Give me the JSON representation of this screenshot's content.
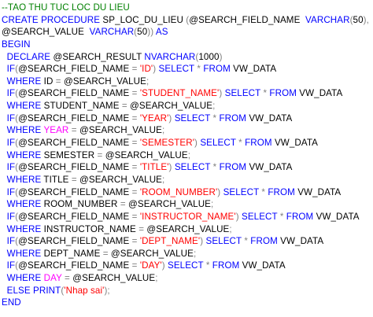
{
  "editor": {
    "lines": [
      [
        {
          "t": "--TAO THU TUC LOC DU LIEU",
          "c": "cmt"
        }
      ],
      [
        {
          "t": "CREATE PROCEDURE",
          "c": "kw"
        },
        {
          "t": " SP_LOC_DU_LIEU ",
          "c": "plain"
        },
        {
          "t": "(",
          "c": "op"
        },
        {
          "t": "@SEARCH_FIELD_NAME  ",
          "c": "plain"
        },
        {
          "t": "VARCHAR",
          "c": "kw"
        },
        {
          "t": "(",
          "c": "op"
        },
        {
          "t": "50",
          "c": "plain"
        },
        {
          "t": "),",
          "c": "op"
        }
      ],
      [
        {
          "t": "@SEARCH_VALUE  ",
          "c": "plain"
        },
        {
          "t": "VARCHAR",
          "c": "kw"
        },
        {
          "t": "(",
          "c": "op"
        },
        {
          "t": "50",
          "c": "plain"
        },
        {
          "t": "))",
          "c": "op"
        },
        {
          "t": " ",
          "c": "plain"
        },
        {
          "t": "AS",
          "c": "kw"
        }
      ],
      [
        {
          "t": "BEGIN",
          "c": "kw"
        }
      ],
      [
        {
          "t": "  ",
          "c": "plain"
        },
        {
          "t": "DECLARE",
          "c": "kw"
        },
        {
          "t": " @SEARCH_RESULT ",
          "c": "plain"
        },
        {
          "t": "NVARCHAR",
          "c": "kw"
        },
        {
          "t": "(",
          "c": "op"
        },
        {
          "t": "1000",
          "c": "plain"
        },
        {
          "t": ")",
          "c": "op"
        }
      ],
      [
        {
          "t": "  ",
          "c": "plain"
        },
        {
          "t": "IF",
          "c": "kw"
        },
        {
          "t": "(",
          "c": "op"
        },
        {
          "t": "@SEARCH_FIELD_NAME ",
          "c": "plain"
        },
        {
          "t": "=",
          "c": "op"
        },
        {
          "t": " ",
          "c": "plain"
        },
        {
          "t": "'ID'",
          "c": "str"
        },
        {
          "t": ")",
          "c": "op"
        },
        {
          "t": " ",
          "c": "plain"
        },
        {
          "t": "SELECT",
          "c": "kw"
        },
        {
          "t": " ",
          "c": "plain"
        },
        {
          "t": "*",
          "c": "op"
        },
        {
          "t": " ",
          "c": "plain"
        },
        {
          "t": "FROM",
          "c": "kw"
        },
        {
          "t": " VW_DATA",
          "c": "plain"
        }
      ],
      [
        {
          "t": "  ",
          "c": "plain"
        },
        {
          "t": "WHERE",
          "c": "kw"
        },
        {
          "t": " ID ",
          "c": "plain"
        },
        {
          "t": "=",
          "c": "op"
        },
        {
          "t": " @SEARCH_VALUE",
          "c": "plain"
        },
        {
          "t": ";",
          "c": "op"
        }
      ],
      [
        {
          "t": "  ",
          "c": "plain"
        },
        {
          "t": "IF",
          "c": "kw"
        },
        {
          "t": "(",
          "c": "op"
        },
        {
          "t": "@SEARCH_FIELD_NAME ",
          "c": "plain"
        },
        {
          "t": "=",
          "c": "op"
        },
        {
          "t": " ",
          "c": "plain"
        },
        {
          "t": "'STUDENT_NAME'",
          "c": "str"
        },
        {
          "t": ")",
          "c": "op"
        },
        {
          "t": " ",
          "c": "plain"
        },
        {
          "t": "SELECT",
          "c": "kw"
        },
        {
          "t": " ",
          "c": "plain"
        },
        {
          "t": "*",
          "c": "op"
        },
        {
          "t": " ",
          "c": "plain"
        },
        {
          "t": "FROM",
          "c": "kw"
        },
        {
          "t": " VW_DATA",
          "c": "plain"
        }
      ],
      [
        {
          "t": "  ",
          "c": "plain"
        },
        {
          "t": "WHERE",
          "c": "kw"
        },
        {
          "t": " STUDENT_NAME ",
          "c": "plain"
        },
        {
          "t": "=",
          "c": "op"
        },
        {
          "t": " @SEARCH_VALUE",
          "c": "plain"
        },
        {
          "t": ";",
          "c": "op"
        }
      ],
      [
        {
          "t": "  ",
          "c": "plain"
        },
        {
          "t": "IF",
          "c": "kw"
        },
        {
          "t": "(",
          "c": "op"
        },
        {
          "t": "@SEARCH_FIELD_NAME ",
          "c": "plain"
        },
        {
          "t": "=",
          "c": "op"
        },
        {
          "t": " ",
          "c": "plain"
        },
        {
          "t": "'YEAR'",
          "c": "str"
        },
        {
          "t": ")",
          "c": "op"
        },
        {
          "t": " ",
          "c": "plain"
        },
        {
          "t": "SELECT",
          "c": "kw"
        },
        {
          "t": " ",
          "c": "plain"
        },
        {
          "t": "*",
          "c": "op"
        },
        {
          "t": " ",
          "c": "plain"
        },
        {
          "t": "FROM",
          "c": "kw"
        },
        {
          "t": " VW_DATA",
          "c": "plain"
        }
      ],
      [
        {
          "t": "  ",
          "c": "plain"
        },
        {
          "t": "WHERE",
          "c": "kw"
        },
        {
          "t": " ",
          "c": "plain"
        },
        {
          "t": "YEAR",
          "c": "fn"
        },
        {
          "t": " ",
          "c": "plain"
        },
        {
          "t": "=",
          "c": "op"
        },
        {
          "t": " @SEARCH_VALUE",
          "c": "plain"
        },
        {
          "t": ";",
          "c": "op"
        }
      ],
      [
        {
          "t": "  ",
          "c": "plain"
        },
        {
          "t": "IF",
          "c": "kw"
        },
        {
          "t": "(",
          "c": "op"
        },
        {
          "t": "@SEARCH_FIELD_NAME ",
          "c": "plain"
        },
        {
          "t": "=",
          "c": "op"
        },
        {
          "t": " ",
          "c": "plain"
        },
        {
          "t": "'SEMESTER'",
          "c": "str"
        },
        {
          "t": ")",
          "c": "op"
        },
        {
          "t": " ",
          "c": "plain"
        },
        {
          "t": "SELECT",
          "c": "kw"
        },
        {
          "t": " ",
          "c": "plain"
        },
        {
          "t": "*",
          "c": "op"
        },
        {
          "t": " ",
          "c": "plain"
        },
        {
          "t": "FROM",
          "c": "kw"
        },
        {
          "t": " VW_DATA",
          "c": "plain"
        }
      ],
      [
        {
          "t": "  ",
          "c": "plain"
        },
        {
          "t": "WHERE",
          "c": "kw"
        },
        {
          "t": " SEMESTER ",
          "c": "plain"
        },
        {
          "t": "=",
          "c": "op"
        },
        {
          "t": " @SEARCH_VALUE",
          "c": "plain"
        },
        {
          "t": ";",
          "c": "op"
        }
      ],
      [
        {
          "t": "  ",
          "c": "plain"
        },
        {
          "t": "IF",
          "c": "kw"
        },
        {
          "t": "(",
          "c": "op"
        },
        {
          "t": "@SEARCH_FIELD_NAME ",
          "c": "plain"
        },
        {
          "t": "=",
          "c": "op"
        },
        {
          "t": " ",
          "c": "plain"
        },
        {
          "t": "'TITLE'",
          "c": "str"
        },
        {
          "t": ")",
          "c": "op"
        },
        {
          "t": " ",
          "c": "plain"
        },
        {
          "t": "SELECT",
          "c": "kw"
        },
        {
          "t": " ",
          "c": "plain"
        },
        {
          "t": "*",
          "c": "op"
        },
        {
          "t": " ",
          "c": "plain"
        },
        {
          "t": "FROM",
          "c": "kw"
        },
        {
          "t": " VW_DATA",
          "c": "plain"
        }
      ],
      [
        {
          "t": "  ",
          "c": "plain"
        },
        {
          "t": "WHERE",
          "c": "kw"
        },
        {
          "t": " TITLE ",
          "c": "plain"
        },
        {
          "t": "=",
          "c": "op"
        },
        {
          "t": " @SEARCH_VALUE",
          "c": "plain"
        },
        {
          "t": ";",
          "c": "op"
        }
      ],
      [
        {
          "t": "  ",
          "c": "plain"
        },
        {
          "t": "IF",
          "c": "kw"
        },
        {
          "t": "(",
          "c": "op"
        },
        {
          "t": "@SEARCH_FIELD_NAME ",
          "c": "plain"
        },
        {
          "t": "=",
          "c": "op"
        },
        {
          "t": " ",
          "c": "plain"
        },
        {
          "t": "'ROOM_NUMBER'",
          "c": "str"
        },
        {
          "t": ")",
          "c": "op"
        },
        {
          "t": " ",
          "c": "plain"
        },
        {
          "t": "SELECT",
          "c": "kw"
        },
        {
          "t": " ",
          "c": "plain"
        },
        {
          "t": "*",
          "c": "op"
        },
        {
          "t": " ",
          "c": "plain"
        },
        {
          "t": "FROM",
          "c": "kw"
        },
        {
          "t": " VW_DATA",
          "c": "plain"
        }
      ],
      [
        {
          "t": "  ",
          "c": "plain"
        },
        {
          "t": "WHERE",
          "c": "kw"
        },
        {
          "t": " ROOM_NUMBER ",
          "c": "plain"
        },
        {
          "t": "=",
          "c": "op"
        },
        {
          "t": " @SEARCH_VALUE",
          "c": "plain"
        },
        {
          "t": ";",
          "c": "op"
        }
      ],
      [
        {
          "t": "  ",
          "c": "plain"
        },
        {
          "t": "IF",
          "c": "kw"
        },
        {
          "t": "(",
          "c": "op"
        },
        {
          "t": "@SEARCH_FIELD_NAME ",
          "c": "plain"
        },
        {
          "t": "=",
          "c": "op"
        },
        {
          "t": " ",
          "c": "plain"
        },
        {
          "t": "'INSTRUCTOR_NAME'",
          "c": "str"
        },
        {
          "t": ")",
          "c": "op"
        },
        {
          "t": " ",
          "c": "plain"
        },
        {
          "t": "SELECT",
          "c": "kw"
        },
        {
          "t": " ",
          "c": "plain"
        },
        {
          "t": "*",
          "c": "op"
        },
        {
          "t": " ",
          "c": "plain"
        },
        {
          "t": "FROM",
          "c": "kw"
        },
        {
          "t": " VW_DATA",
          "c": "plain"
        }
      ],
      [
        {
          "t": "  ",
          "c": "plain"
        },
        {
          "t": "WHERE",
          "c": "kw"
        },
        {
          "t": " INSTRUCTOR_NAME ",
          "c": "plain"
        },
        {
          "t": "=",
          "c": "op"
        },
        {
          "t": " @SEARCH_VALUE",
          "c": "plain"
        },
        {
          "t": ";",
          "c": "op"
        }
      ],
      [
        {
          "t": "  ",
          "c": "plain"
        },
        {
          "t": "IF",
          "c": "kw"
        },
        {
          "t": "(",
          "c": "op"
        },
        {
          "t": "@SEARCH_FIELD_NAME ",
          "c": "plain"
        },
        {
          "t": "=",
          "c": "op"
        },
        {
          "t": " ",
          "c": "plain"
        },
        {
          "t": "'DEPT_NAME'",
          "c": "str"
        },
        {
          "t": ")",
          "c": "op"
        },
        {
          "t": " ",
          "c": "plain"
        },
        {
          "t": "SELECT",
          "c": "kw"
        },
        {
          "t": " ",
          "c": "plain"
        },
        {
          "t": "*",
          "c": "op"
        },
        {
          "t": " ",
          "c": "plain"
        },
        {
          "t": "FROM",
          "c": "kw"
        },
        {
          "t": " VW_DATA",
          "c": "plain"
        }
      ],
      [
        {
          "t": "  ",
          "c": "plain"
        },
        {
          "t": "WHERE",
          "c": "kw"
        },
        {
          "t": " DEPT_NAME ",
          "c": "plain"
        },
        {
          "t": "=",
          "c": "op"
        },
        {
          "t": " @SEARCH_VALUE",
          "c": "plain"
        },
        {
          "t": ";",
          "c": "op"
        }
      ],
      [
        {
          "t": "  ",
          "c": "plain"
        },
        {
          "t": "IF",
          "c": "kw"
        },
        {
          "t": "(",
          "c": "op"
        },
        {
          "t": "@SEARCH_FIELD_NAME ",
          "c": "plain"
        },
        {
          "t": "=",
          "c": "op"
        },
        {
          "t": " ",
          "c": "plain"
        },
        {
          "t": "'DAY'",
          "c": "str"
        },
        {
          "t": ")",
          "c": "op"
        },
        {
          "t": " ",
          "c": "plain"
        },
        {
          "t": "SELECT",
          "c": "kw"
        },
        {
          "t": " ",
          "c": "plain"
        },
        {
          "t": "*",
          "c": "op"
        },
        {
          "t": " ",
          "c": "plain"
        },
        {
          "t": "FROM",
          "c": "kw"
        },
        {
          "t": " VW_DATA",
          "c": "plain"
        }
      ],
      [
        {
          "t": "  ",
          "c": "plain"
        },
        {
          "t": "WHERE",
          "c": "kw"
        },
        {
          "t": " ",
          "c": "plain"
        },
        {
          "t": "DAY",
          "c": "fn"
        },
        {
          "t": " ",
          "c": "plain"
        },
        {
          "t": "=",
          "c": "op"
        },
        {
          "t": " @SEARCH_VALUE",
          "c": "plain"
        },
        {
          "t": ";",
          "c": "op"
        }
      ],
      [
        {
          "t": "  ",
          "c": "plain"
        },
        {
          "t": "ELSE",
          "c": "kw"
        },
        {
          "t": " ",
          "c": "plain"
        },
        {
          "t": "PRINT",
          "c": "kw"
        },
        {
          "t": "(",
          "c": "op"
        },
        {
          "t": "'Nhap sai'",
          "c": "str"
        },
        {
          "t": ");",
          "c": "op"
        }
      ],
      [
        {
          "t": "END",
          "c": "kw"
        }
      ]
    ]
  },
  "colors": {
    "keyword": "#0000ff",
    "string": "#ff0000",
    "comment": "#008000",
    "operator": "#808080",
    "function": "#ff00ff",
    "identifier": "#000000",
    "background": "#ffffff"
  }
}
